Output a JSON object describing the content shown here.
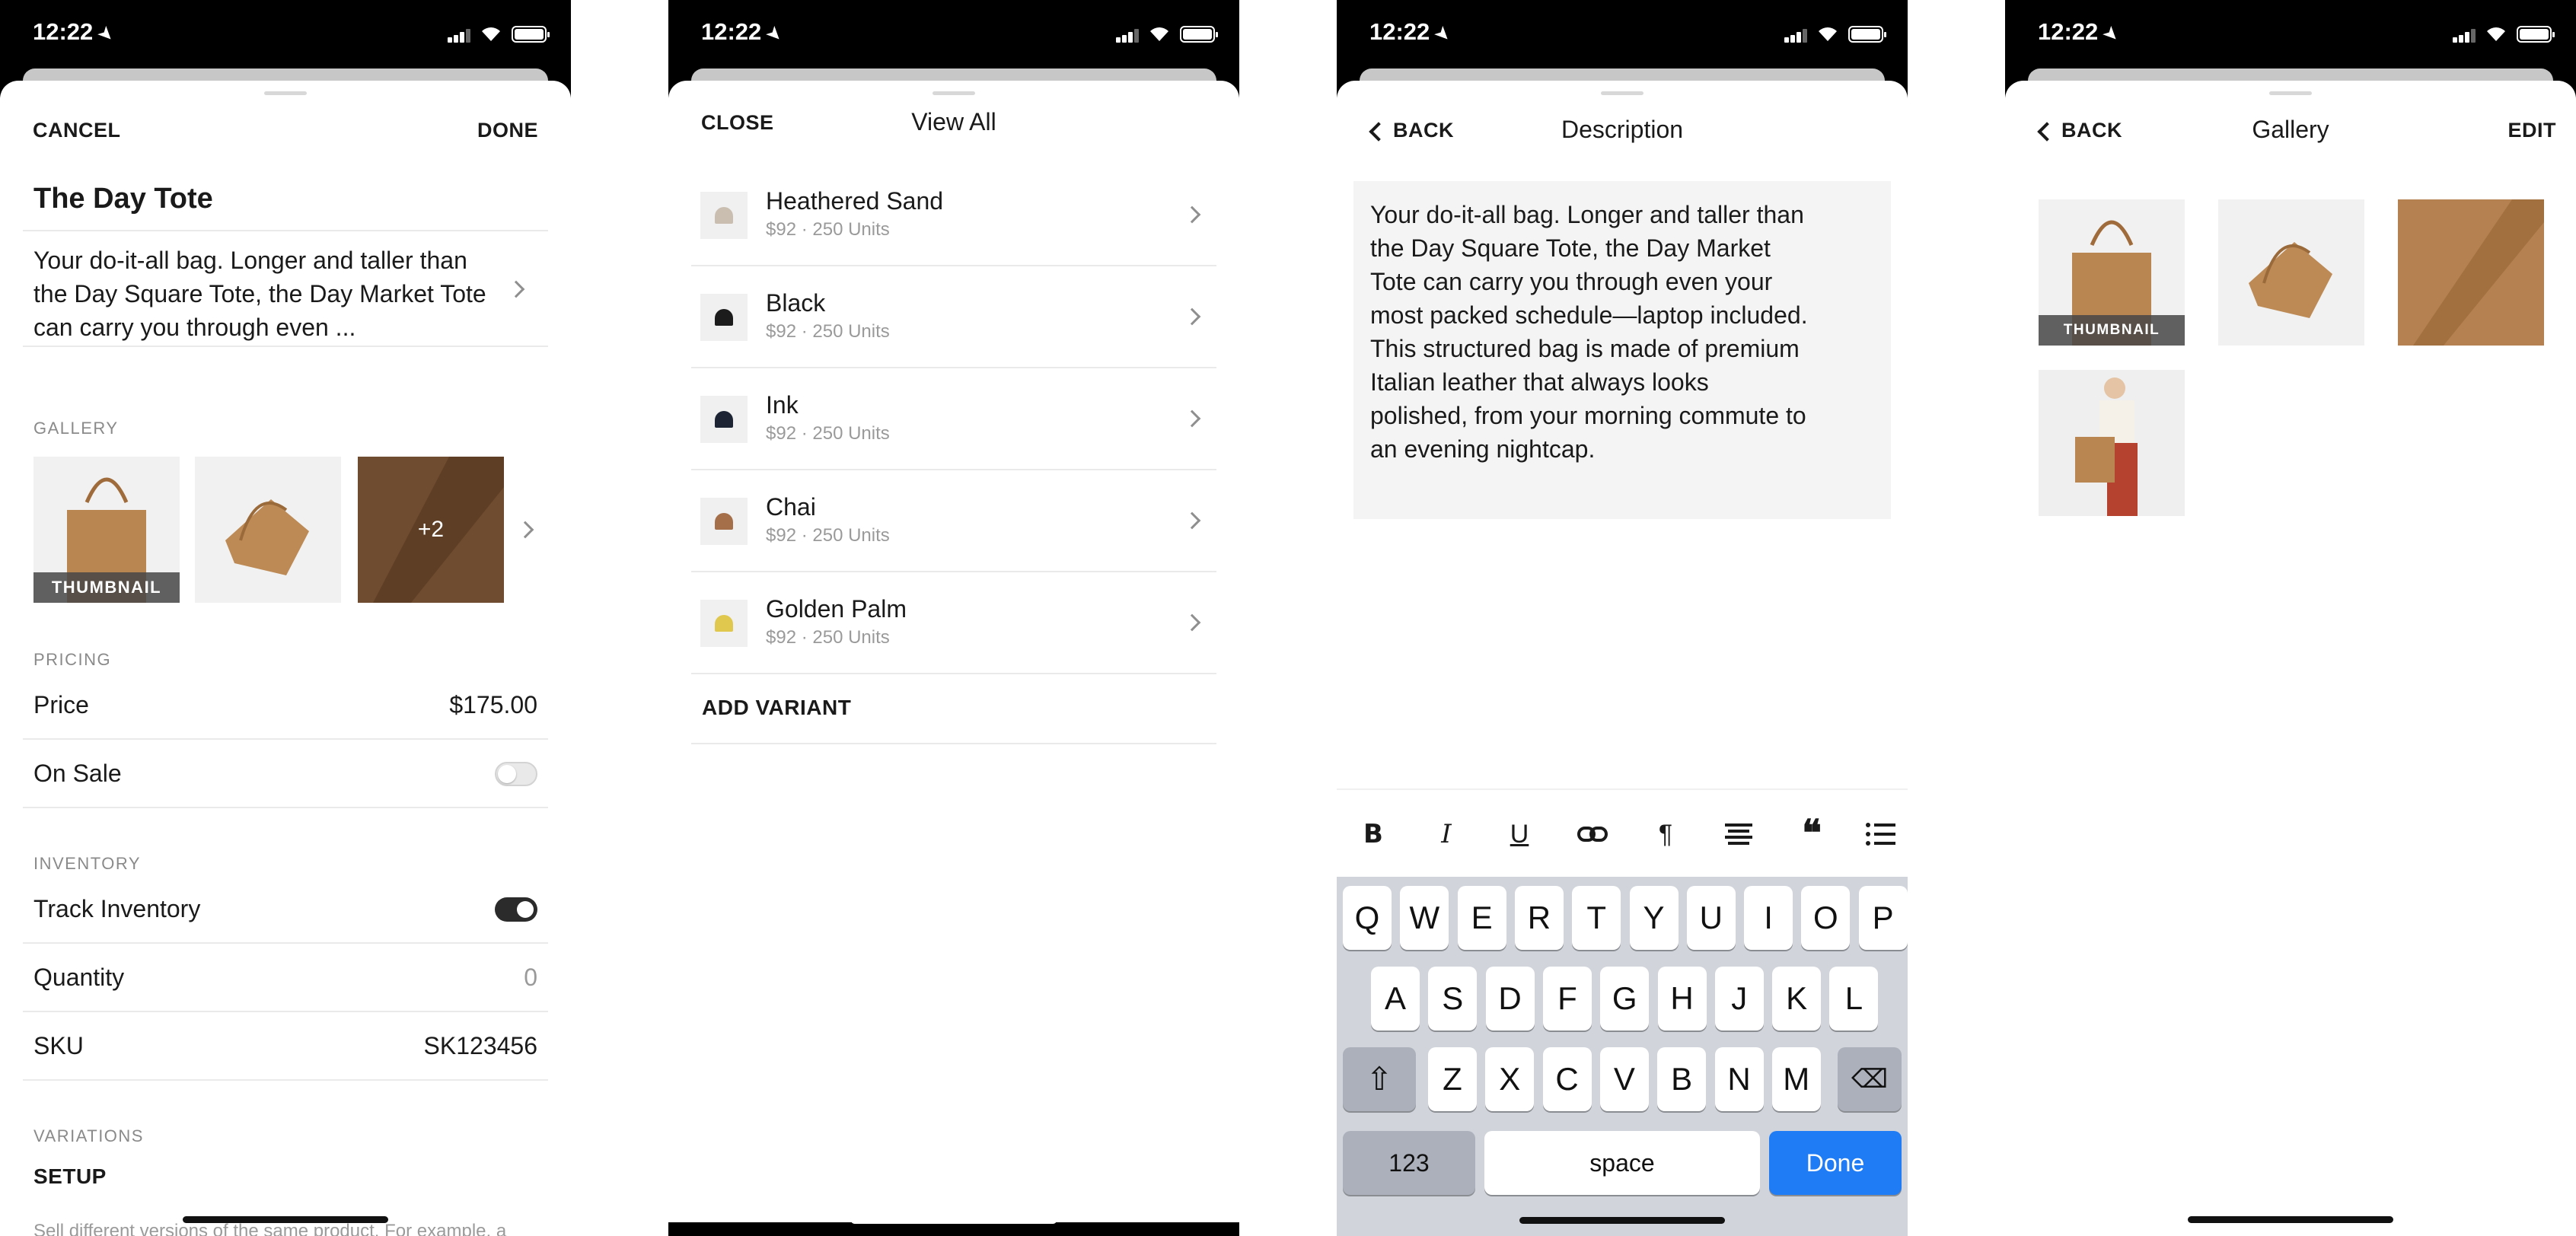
{
  "status": {
    "time": "12:22"
  },
  "product_editor": {
    "cancel_label": "CANCEL",
    "done_label": "DONE",
    "title": "The Day Tote",
    "description_preview": "Your do-it-all bag. Longer and taller than the Day Square Tote, the Day Market Tote can carry you through even ...",
    "gallery_label": "GALLERY",
    "thumbnail_label": "THUMBNAIL",
    "more_images": "+2",
    "pricing_label": "PRICING",
    "price_label": "Price",
    "price_value": "$175.00",
    "on_sale_label": "On Sale",
    "on_sale": false,
    "inventory_label": "INVENTORY",
    "track_inventory_label": "Track Inventory",
    "track_inventory": true,
    "quantity_label": "Quantity",
    "quantity_value": "0",
    "sku_label": "SKU",
    "sku_value": "SK123456",
    "variations_label": "VARIATIONS",
    "setup_label": "SETUP",
    "setup_help": "Sell different versions of the same product. For example, a"
  },
  "variants_view": {
    "close_label": "CLOSE",
    "title": "View All",
    "variants": [
      {
        "name": "Heathered Sand",
        "detail": "$92 · 250 Units",
        "color": "#c9beb0"
      },
      {
        "name": "Black",
        "detail": "$92 · 250 Units",
        "color": "#1c1c1c"
      },
      {
        "name": "Ink",
        "detail": "$92 · 250 Units",
        "color": "#1d2433"
      },
      {
        "name": "Chai",
        "detail": "$92 · 250 Units",
        "color": "#a56f4a"
      },
      {
        "name": "Golden Palm",
        "detail": "$92 · 250 Units",
        "color": "#e0c74d"
      }
    ],
    "add_variant_label": "ADD VARIANT"
  },
  "description_view": {
    "back_label": "BACK",
    "title": "Description",
    "text": "Your do-it-all bag. Longer and taller than the Day Square Tote, the Day Market Tote can carry you through even your most packed schedule—laptop included. This structured bag is made of premium Italian leather that always looks polished, from your morning commute to an evening nightcap.",
    "toolbar_icons": [
      "bold-icon",
      "italic-icon",
      "underline-icon",
      "link-icon",
      "paragraph-icon",
      "align-icon",
      "quote-icon",
      "list-icon"
    ],
    "keyboard": {
      "row1": [
        "Q",
        "W",
        "E",
        "R",
        "T",
        "Y",
        "U",
        "I",
        "O",
        "P"
      ],
      "row2": [
        "A",
        "S",
        "D",
        "F",
        "G",
        "H",
        "J",
        "K",
        "L"
      ],
      "row3": [
        "Z",
        "X",
        "C",
        "V",
        "B",
        "N",
        "M"
      ],
      "numbers_label": "123",
      "space_label": "space",
      "done_label": "Done"
    }
  },
  "gallery_view": {
    "back_label": "BACK",
    "title": "Gallery",
    "edit_label": "EDIT",
    "thumbnail_label": "THUMBNAIL"
  },
  "colors": {
    "accent": "#1f7cf5",
    "leather": "#b98550"
  }
}
